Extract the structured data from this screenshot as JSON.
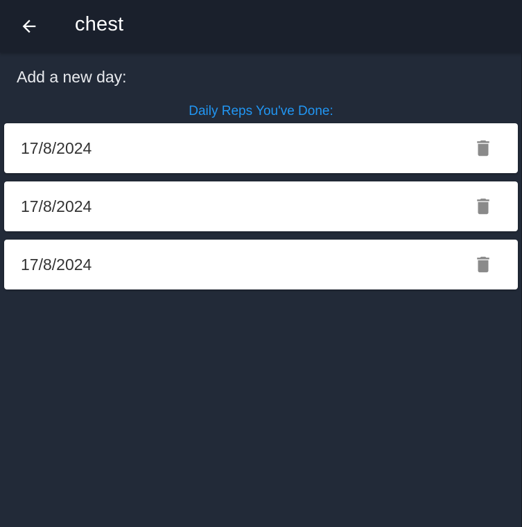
{
  "app_bar": {
    "title": "chest",
    "back_icon": "arrow-left-icon"
  },
  "main": {
    "add_day_label": "Add a new day:",
    "section_heading": "Daily Reps You've Done:",
    "entries": [
      {
        "date": "17/8/2024",
        "delete_icon": "trash-icon"
      },
      {
        "date": "17/8/2024",
        "delete_icon": "trash-icon"
      },
      {
        "date": "17/8/2024",
        "delete_icon": "trash-icon"
      }
    ]
  },
  "colors": {
    "background": "#222a38",
    "app_bar": "#1a202c",
    "accent": "#2196f3",
    "card": "#ffffff",
    "icon_grey": "#8a8a8a"
  }
}
